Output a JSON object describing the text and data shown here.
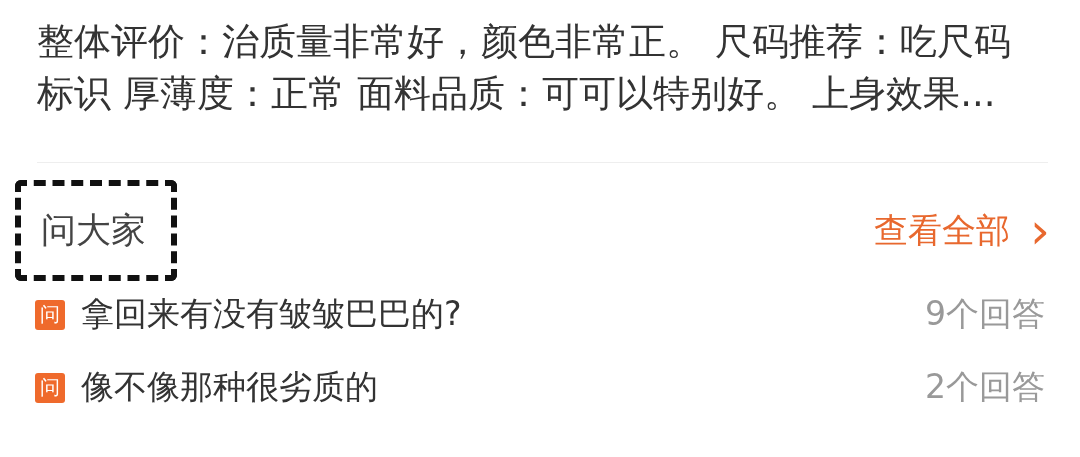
{
  "review": {
    "text": "整体评价：治质量非常好，颜色非常正。 尺码推荐：吃尺码标识 厚薄度：正常 面料品质：可可以特别好。 上身效果..."
  },
  "ask_section": {
    "title": "问大家",
    "highlighted": true,
    "view_all": "查看全部",
    "view_all_arrow": "›",
    "questions": [
      {
        "badge": "问",
        "text": "拿回来有没有皱皱巴巴的?",
        "answers": "9个回答"
      },
      {
        "badge": "问",
        "text": "像不像那种很劣质的",
        "answers": "2个回答"
      }
    ]
  }
}
